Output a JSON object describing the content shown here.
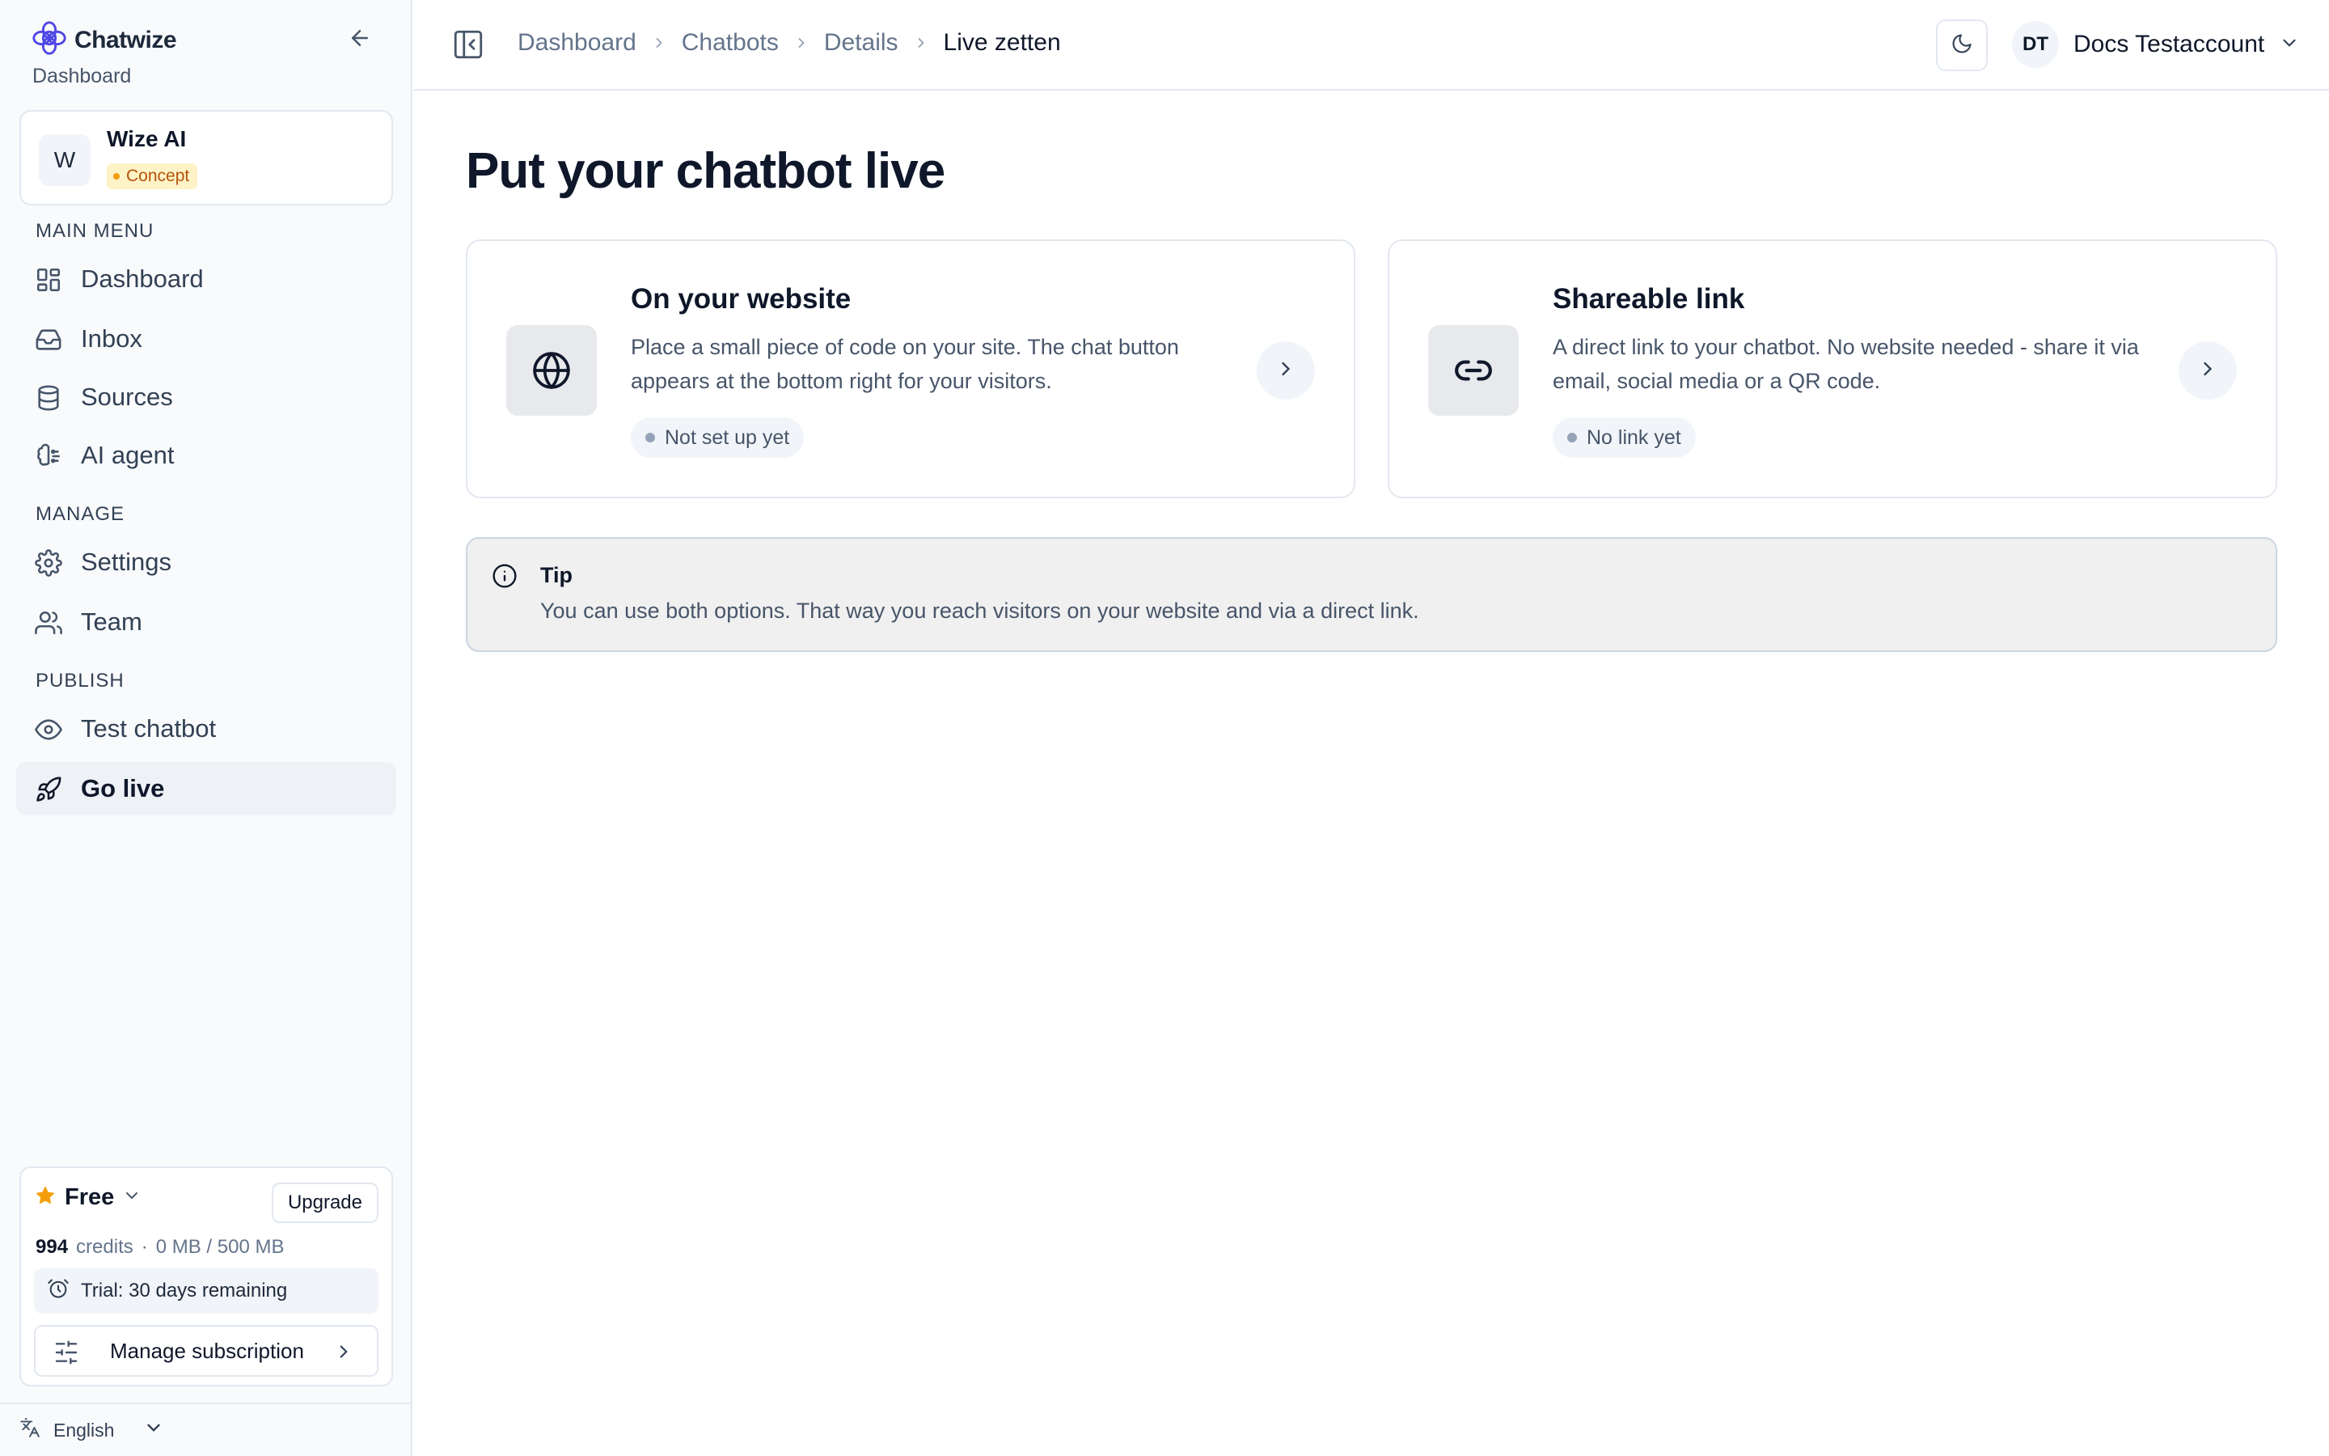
{
  "brand": {
    "name": "Chatwize",
    "subtitle": "Dashboard"
  },
  "bot": {
    "initial": "W",
    "name": "Wize AI",
    "status": "Concept"
  },
  "sidebar": {
    "sections": [
      {
        "title": "MAIN MENU",
        "items": [
          {
            "label": "Dashboard",
            "icon": "layout-dashboard-icon"
          },
          {
            "label": "Inbox",
            "icon": "inbox-icon"
          },
          {
            "label": "Sources",
            "icon": "database-icon"
          },
          {
            "label": "AI agent",
            "icon": "brain-icon"
          }
        ]
      },
      {
        "title": "MANAGE",
        "items": [
          {
            "label": "Settings",
            "icon": "gear-icon"
          },
          {
            "label": "Team",
            "icon": "users-icon"
          }
        ]
      },
      {
        "title": "PUBLISH",
        "items": [
          {
            "label": "Test chatbot",
            "icon": "eye-icon"
          },
          {
            "label": "Go live",
            "icon": "rocket-icon",
            "active": true
          }
        ]
      }
    ]
  },
  "plan": {
    "name": "Free",
    "upgrade_label": "Upgrade",
    "credits_value": "994",
    "credits_label": "credits",
    "separator": "·",
    "storage": "0 MB / 500 MB",
    "trial": "Trial: 30 days remaining",
    "manage_label": "Manage subscription"
  },
  "language": "English",
  "header": {
    "breadcrumb": [
      "Dashboard",
      "Chatbots",
      "Details",
      "Live zetten"
    ],
    "user_initials": "DT",
    "user_name": "Docs Testaccount"
  },
  "main": {
    "title": "Put your chatbot live",
    "cards": [
      {
        "title": "On your website",
        "description": "Place a small piece of code on your site. The chat button appears at the bottom right for your visitors.",
        "status": "Not set up yet",
        "icon": "globe-icon"
      },
      {
        "title": "Shareable link",
        "description": "A direct link to your chatbot. No website needed - share it via email, social media or a QR code.",
        "status": "No link yet",
        "icon": "link-icon"
      }
    ],
    "tip": {
      "title": "Tip",
      "text": "You can use both options. That way you reach visitors on your website and via a direct link."
    }
  },
  "colors": {
    "accent": "#4f46e5",
    "concept_badge_bg": "#fef3c7",
    "concept_badge_text": "#b45309",
    "star": "#f59e0b"
  }
}
